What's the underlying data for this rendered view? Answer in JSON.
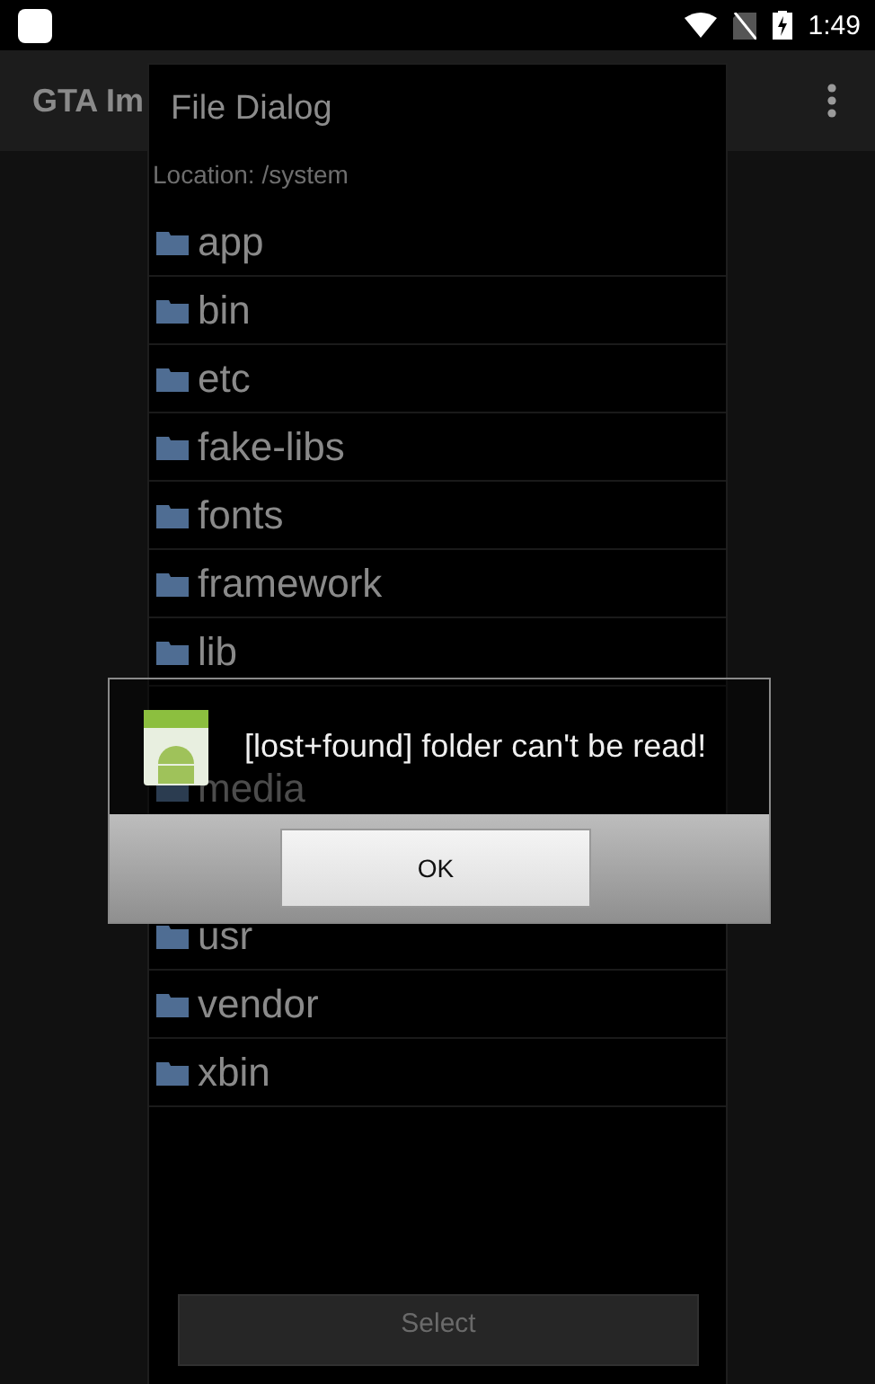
{
  "status_bar": {
    "time": "1:49"
  },
  "app_bar": {
    "title": "GTA Im"
  },
  "file_dialog": {
    "title": "File Dialog",
    "location": "Location: /system",
    "folders_above": [
      {
        "name": "app"
      },
      {
        "name": "bin"
      },
      {
        "name": "etc"
      },
      {
        "name": "fake-libs"
      },
      {
        "name": "fonts"
      },
      {
        "name": "framework"
      },
      {
        "name": "lib"
      }
    ],
    "folders_below": [
      {
        "name": "media"
      },
      {
        "name": "usr"
      },
      {
        "name": "vendor"
      },
      {
        "name": "xbin"
      }
    ],
    "select_button": "Select"
  },
  "alert": {
    "message": "[lost+found] folder can't be read!",
    "button": "OK"
  }
}
